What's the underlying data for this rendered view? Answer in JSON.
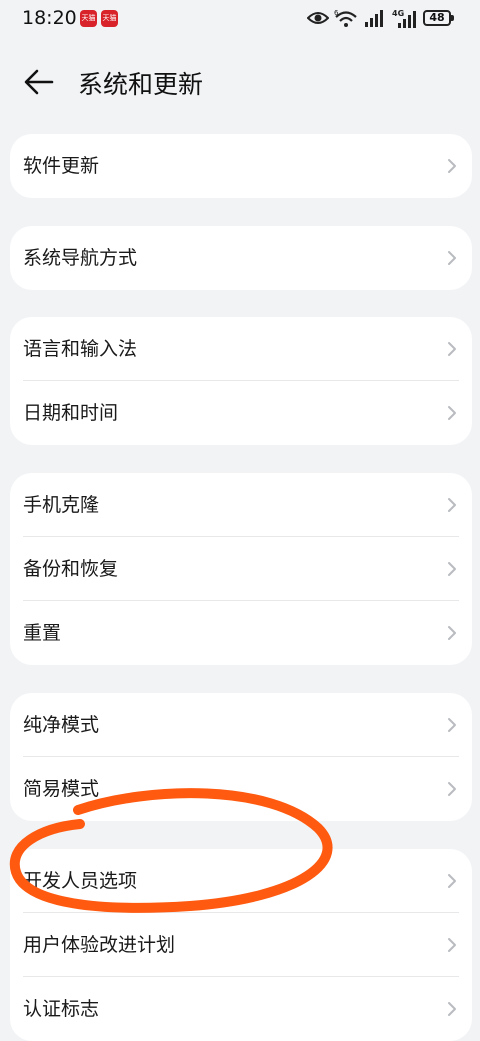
{
  "status_bar": {
    "time": "18:20",
    "app_badges": [
      "天猫",
      "天猫"
    ],
    "network": "4G",
    "wifi_label": "6",
    "battery": "48"
  },
  "header": {
    "title": "系统和更新",
    "back_icon": "arrow-left-icon"
  },
  "groups": [
    {
      "items": [
        {
          "label": "软件更新"
        }
      ]
    },
    {
      "items": [
        {
          "label": "系统导航方式"
        }
      ]
    },
    {
      "items": [
        {
          "label": "语言和输入法"
        },
        {
          "label": "日期和时间"
        }
      ]
    },
    {
      "items": [
        {
          "label": "手机克隆"
        },
        {
          "label": "备份和恢复"
        },
        {
          "label": "重置"
        }
      ]
    },
    {
      "items": [
        {
          "label": "纯净模式"
        },
        {
          "label": "简易模式"
        }
      ]
    },
    {
      "items": [
        {
          "label": "开发人员选项"
        },
        {
          "label": "用户体验改进计划"
        },
        {
          "label": "认证标志"
        }
      ]
    }
  ],
  "colors": {
    "background": "#f1f3f5",
    "card": "#ffffff",
    "annotation": "#ff5a10",
    "chevron": "#b8bbbf"
  }
}
